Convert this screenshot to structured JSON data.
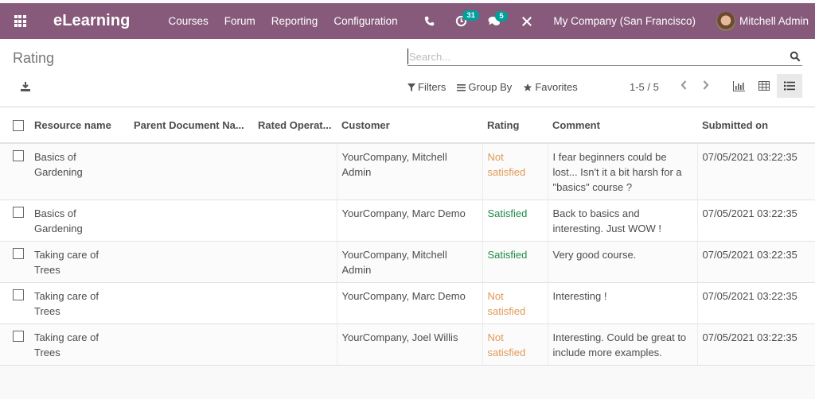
{
  "navbar": {
    "app_name": "eLearning",
    "menu": [
      "Courses",
      "Forum",
      "Reporting",
      "Configuration"
    ],
    "activity_count": "31",
    "message_count": "5",
    "company": "My Company (San Francisco)",
    "user": "Mitchell Admin"
  },
  "control": {
    "title": "Rating",
    "search_placeholder": "Search...",
    "filters_label": "Filters",
    "groupby_label": "Group By",
    "favorites_label": "Favorites",
    "pager": "1-5 / 5",
    "active_view": "list"
  },
  "table": {
    "columns": [
      "Resource name",
      "Parent Document Na...",
      "Rated Operat...",
      "Customer",
      "Rating",
      "Comment",
      "Submitted on"
    ],
    "rows": [
      {
        "resource": "Basics of Gardening",
        "parent": "",
        "operator": "",
        "customer": "YourCompany, Mitchell Admin",
        "rating": "Not satisfied",
        "rating_status": "not",
        "comment": "I fear beginners could be lost... Isn't it a bit harsh for a \"basics\" course ?",
        "submitted": "07/05/2021 03:22:35"
      },
      {
        "resource": "Basics of Gardening",
        "parent": "",
        "operator": "",
        "customer": "YourCompany, Marc Demo",
        "rating": "Satisfied",
        "rating_status": "sat",
        "comment": "Back to basics and interesting. Just WOW !",
        "submitted": "07/05/2021 03:22:35"
      },
      {
        "resource": "Taking care of Trees",
        "parent": "",
        "operator": "",
        "customer": "YourCompany, Mitchell Admin",
        "rating": "Satisfied",
        "rating_status": "sat",
        "comment": "Very good course.",
        "submitted": "07/05/2021 03:22:35"
      },
      {
        "resource": "Taking care of Trees",
        "parent": "",
        "operator": "",
        "customer": "YourCompany, Marc Demo",
        "rating": "Not satisfied",
        "rating_status": "not",
        "comment": "Interesting !",
        "submitted": "07/05/2021 03:22:35"
      },
      {
        "resource": "Taking care of Trees",
        "parent": "",
        "operator": "",
        "customer": "YourCompany, Joel Willis",
        "rating": "Not satisfied",
        "rating_status": "not",
        "comment": "Interesting. Could be great to include more examples.",
        "submitted": "07/05/2021 03:22:35"
      }
    ]
  },
  "colors": {
    "brand": "#875a7b",
    "badge": "#00a09d",
    "not_satisfied": "#e09a59",
    "satisfied": "#1f8a49"
  }
}
